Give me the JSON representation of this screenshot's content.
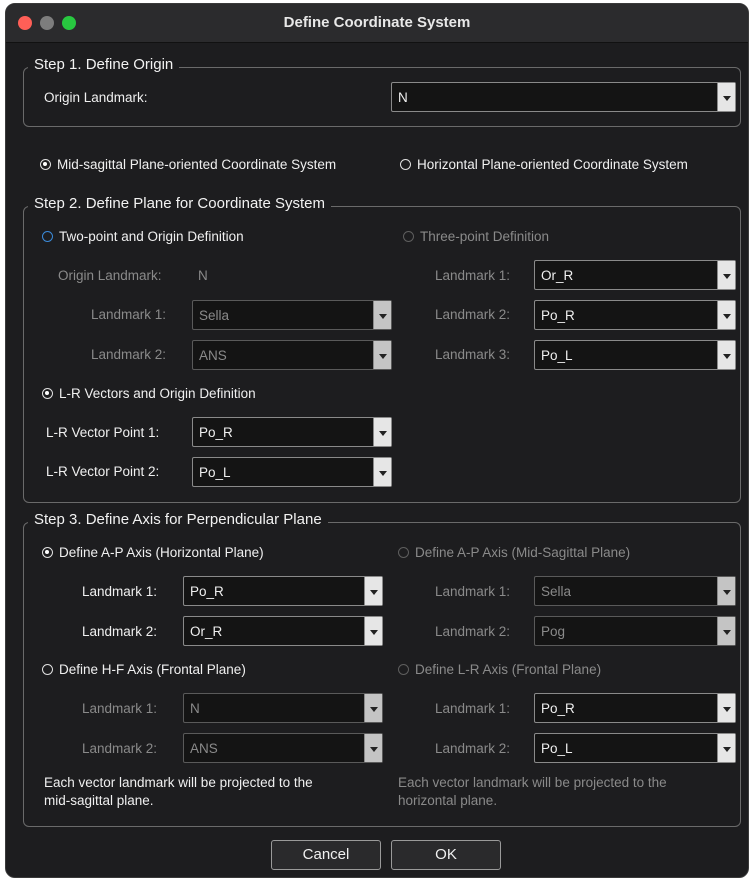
{
  "window": {
    "title": "Define Coordinate System"
  },
  "step1": {
    "legend": "Step 1. Define Origin",
    "origin_label": "Origin Landmark:",
    "origin_value": "N"
  },
  "system": {
    "mid_sagittal": "Mid-sagittal Plane-oriented Coordinate System",
    "horizontal": "Horizontal Plane-oriented Coordinate System"
  },
  "step2": {
    "legend": "Step 2. Define Plane for Coordinate System",
    "two_point": {
      "label": "Two-point and Origin Definition",
      "origin_label": "Origin Landmark:",
      "origin_value": "N",
      "l1_label": "Landmark 1:",
      "l1_value": "Sella",
      "l2_label": "Landmark 2:",
      "l2_value": "ANS"
    },
    "three_point": {
      "label": "Three-point Definition",
      "l1_label": "Landmark 1:",
      "l1_value": "Or_R",
      "l2_label": "Landmark 2:",
      "l2_value": "Po_R",
      "l3_label": "Landmark 3:",
      "l3_value": "Po_L"
    },
    "lr": {
      "label": "L-R Vectors and Origin Definition",
      "p1_label": "L-R Vector Point 1:",
      "p1_value": "Po_R",
      "p2_label": "L-R Vector Point 2:",
      "p2_value": "Po_L"
    }
  },
  "step3": {
    "legend": "Step 3. Define Axis for Perpendicular Plane",
    "ap_h": {
      "label": "Define A-P Axis (Horizontal Plane)",
      "l1_label": "Landmark 1:",
      "l1_value": "Po_R",
      "l2_label": "Landmark 2:",
      "l2_value": "Or_R"
    },
    "ap_m": {
      "label": "Define A-P Axis (Mid-Sagittal Plane)",
      "l1_label": "Landmark 1:",
      "l1_value": "Sella",
      "l2_label": "Landmark 2:",
      "l2_value": "Pog"
    },
    "hf": {
      "label": "Define H-F Axis (Frontal Plane)",
      "l1_label": "Landmark 1:",
      "l1_value": "N",
      "l2_label": "Landmark 2:",
      "l2_value": "ANS"
    },
    "lr_f": {
      "label": "Define L-R Axis (Frontal Plane)",
      "l1_label": "Landmark 1:",
      "l1_value": "Po_R",
      "l2_label": "Landmark 2:",
      "l2_value": "Po_L"
    },
    "note_left_1": "Each vector landmark will be projected to the",
    "note_left_2": "mid-sagittal plane.",
    "note_right_1": "Each vector landmark will be projected to the",
    "note_right_2": "horizontal plane."
  },
  "buttons": {
    "cancel": "Cancel",
    "ok": "OK"
  },
  "colors": {
    "close": "#ff5f57",
    "minimize": "#7d7d7d",
    "zoom": "#28c840"
  }
}
